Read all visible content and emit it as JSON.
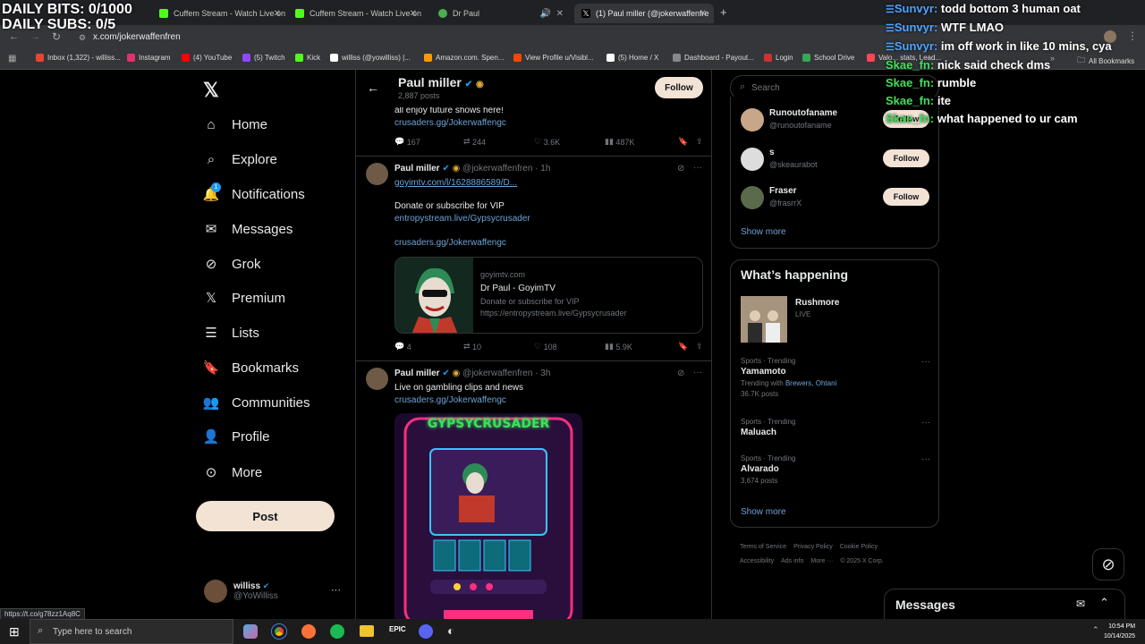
{
  "overlay": {
    "bits": "DAILY BITS: 0/1000",
    "subs": "DAILY SUBS: 0/5"
  },
  "chat": [
    {
      "user": "Sunvyr:",
      "msg": "todd bottom 3 human oat",
      "color": "u1"
    },
    {
      "user": "Sunvyr:",
      "msg": "WTF LMAO",
      "color": "u1"
    },
    {
      "user": "Sunvyr:",
      "msg": "im off work in like 10 mins, cya",
      "color": "u1"
    },
    {
      "user": "Skae_fn:",
      "msg": "nick said check dms",
      "color": "u2"
    },
    {
      "user": "Skae_fn:",
      "msg": "rumble",
      "color": "u2"
    },
    {
      "user": "Skae_fn:",
      "msg": "ite",
      "color": "u2"
    },
    {
      "user": "Skae_fn:",
      "msg": "what happened to ur cam",
      "color": "u2"
    }
  ],
  "browser": {
    "tabs": [
      {
        "label": "Cuffem Stream - Watch Live on",
        "color": "#53fc18"
      },
      {
        "label": "Cuffem Stream - Watch Live on",
        "color": "#53fc18"
      },
      {
        "label": "Dr Paul",
        "color": "#4caf50"
      },
      {
        "label": "(1) Paul miller (@jokerwaffenfre",
        "color": "#ffffff"
      }
    ],
    "new_tab": "+",
    "url": "x.com/jokerwaffenfren",
    "bookmarks": [
      {
        "label": "Inbox (1,322) - williss...",
        "color": "#ea4335"
      },
      {
        "label": "Instagram",
        "color": "#e1306c"
      },
      {
        "label": "(4) YouTube",
        "color": "#ff0000"
      },
      {
        "label": "(5) Twitch",
        "color": "#9146ff"
      },
      {
        "label": "Kick",
        "color": "#53fc18"
      },
      {
        "label": "williss (@yowilliss) |...",
        "color": "#ffffff"
      },
      {
        "label": "Amazon.com. Spen...",
        "color": "#ff9900"
      },
      {
        "label": "View Profile u/Visibl...",
        "color": "#ff4500"
      },
      {
        "label": "(5) Home / X",
        "color": "#ffffff"
      },
      {
        "label": "Dashboard - Payout...",
        "color": "#888888"
      },
      {
        "label": "Login",
        "color": "#cc3333"
      },
      {
        "label": "School Drive",
        "color": "#34a853"
      },
      {
        "label": "Valo... stats, Lead...",
        "color": "#ff4655"
      }
    ],
    "all_bookmarks": "All Bookmarks",
    "status_url": "https://t.co/g78zz1Aq8C"
  },
  "nav": {
    "items": [
      "Home",
      "Explore",
      "Notifications",
      "Messages",
      "Grok",
      "Premium",
      "Lists",
      "Bookmarks",
      "Communities",
      "Profile",
      "More"
    ],
    "notif_count": "1",
    "post": "Post",
    "user_name": "williss",
    "user_handle": "@YoWilliss"
  },
  "profile_header": {
    "name": "Paul miller",
    "posts": "2,887 posts",
    "follow": "Follow"
  },
  "tweets": [
    {
      "text_partial": "all enjoy future shows here!",
      "link": "crusaders.gg/Jokerwaffengc",
      "replies": "167",
      "retweets": "244",
      "likes": "3.6K",
      "views": "487K"
    },
    {
      "name": "Paul miller",
      "handle": "@jokerwaffenfren",
      "time": "· 1h",
      "link1": "goyimtv.com/l/16288865​89/D...",
      "text": "Donate or subscribe for VIP",
      "link2": "entropystream.live/Gypsycrusader",
      "link3": "crusaders.gg/Jokerwaffengc",
      "card_domain": "goyimtv.com",
      "card_title": "Dr Paul - GoyimTV",
      "card_desc": "Donate or subscribe for VIP",
      "card_url": "https://entropystream.live/Gypsycrusader",
      "replies": "4",
      "retweets": "10",
      "likes": "108",
      "views": "5.9K"
    },
    {
      "name": "Paul miller",
      "handle": "@jokerwaffenfren",
      "time": "· 3h",
      "text": "Live on gambling clips and news",
      "link": "crusaders.gg/Jokerwaffengc",
      "media_title": "GYPSYCRUSADER"
    }
  ],
  "right": {
    "search_placeholder": "Search",
    "follow_suggestions": [
      {
        "name": "Runoutofaname",
        "handle": "@runoutofaname",
        "btn": "Follow"
      },
      {
        "name": "s",
        "handle": "@skeaurabot",
        "btn": "Follow"
      },
      {
        "name": "Fraser",
        "handle": "@frasrrX",
        "btn": "Follow"
      }
    ],
    "show_more": "Show more",
    "happening_title": "What’s happening",
    "live_title": "Rushmore",
    "live_label": "LIVE",
    "trends": [
      {
        "meta": "Sports · Trending",
        "name": "Yamamoto",
        "with_label": "Trending with",
        "with": "Brewers, Ohtani",
        "posts": "36.7K posts"
      },
      {
        "meta": "Sports · Trending",
        "name": "Maluach",
        "with_label": "",
        "with": "",
        "posts": ""
      },
      {
        "meta": "Sports · Trending",
        "name": "Alvarado",
        "with_label": "",
        "with": "",
        "posts": "3,674 posts"
      }
    ],
    "show_more2": "Show more",
    "footer": [
      "Terms of Service",
      "Privacy Policy",
      "Cookie Policy",
      "Accessibility",
      "Ads info",
      "More ···",
      "© 2025 X Corp."
    ]
  },
  "messages_dock": "Messages",
  "taskbar": {
    "search": "Type here to search",
    "time": "10:54 PM",
    "date": "10/14/2025"
  }
}
